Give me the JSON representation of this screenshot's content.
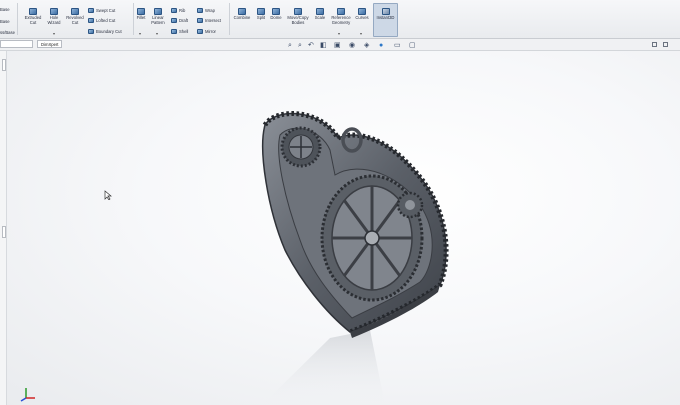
{
  "ribbon": {
    "left_partial": [
      "Base",
      "Base",
      "ss/Base"
    ],
    "features": {
      "extruded_cut": "Extruded Cut",
      "hole_wizard": "Hole Wizard",
      "revolved_cut": "Revolved Cut",
      "swept_cut": "Swept Cut",
      "lofted_cut": "Lofted Cut",
      "boundary_cut": "Boundary Cut",
      "fillet": "Fillet",
      "linear_pattern": "Linear Pattern",
      "rib": "Rib",
      "draft": "Draft",
      "shell": "Shell",
      "wrap": "Wrap",
      "intersect": "Intersect",
      "mirror": "Mirror",
      "combine": "Combine",
      "split": "Split",
      "dome": "Dome",
      "move_copy_bodies": "Move/Copy Bodies",
      "scale": "Scale",
      "reference_geometry": "Reference Geometry",
      "curves": "Curves",
      "instant3d": "Instant3D"
    }
  },
  "tabs": {
    "first": "",
    "second": "DimXpert"
  },
  "icons": {
    "heads_up_toolbar": [
      "zoom-to-fit-icon",
      "zoom-area-icon",
      "previous-view-icon",
      "section-view-icon",
      "view-orientation-icon",
      "display-style-icon",
      "hide-show-icon",
      "appearance-icon",
      "scene-icon",
      "view-settings-icon"
    ],
    "cursor": "mouse-pointer-icon",
    "triad": "reference-triad-icon"
  },
  "colors": {
    "accent": "#3d6ea3",
    "model_metal": "#5e636c"
  }
}
